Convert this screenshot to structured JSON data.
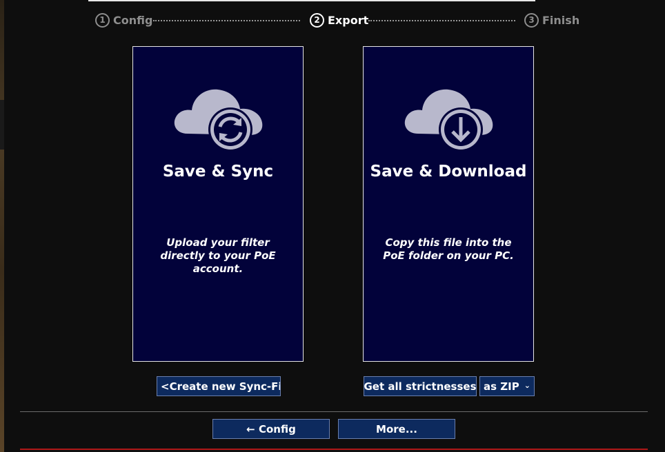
{
  "stepper": {
    "steps": [
      {
        "number": "1",
        "label": "Config",
        "state": "inactive"
      },
      {
        "number": "2",
        "label": "Export",
        "state": "active"
      },
      {
        "number": "3",
        "label": "Finish",
        "state": "inactive"
      }
    ]
  },
  "cards": {
    "sync": {
      "icon": "cloud-sync-icon",
      "title": "Save & Sync",
      "description": "Upload your filter directly to your PoE account."
    },
    "download": {
      "icon": "cloud-download-icon",
      "title": "Save & Download",
      "description": "Copy this file into the PoE folder on your PC."
    }
  },
  "controls": {
    "sync_select_value": "<Create new Sync-Filter>",
    "strictness_button": "Get all strictnesses",
    "format_select_value": "as ZIP"
  },
  "footer": {
    "config_button": "← Config",
    "more_button": "More..."
  },
  "colors": {
    "card_bg": "#02023a",
    "button_bg": "#0d2a5e",
    "icon": "#b8b8cc",
    "accent_red": "#b01818"
  }
}
